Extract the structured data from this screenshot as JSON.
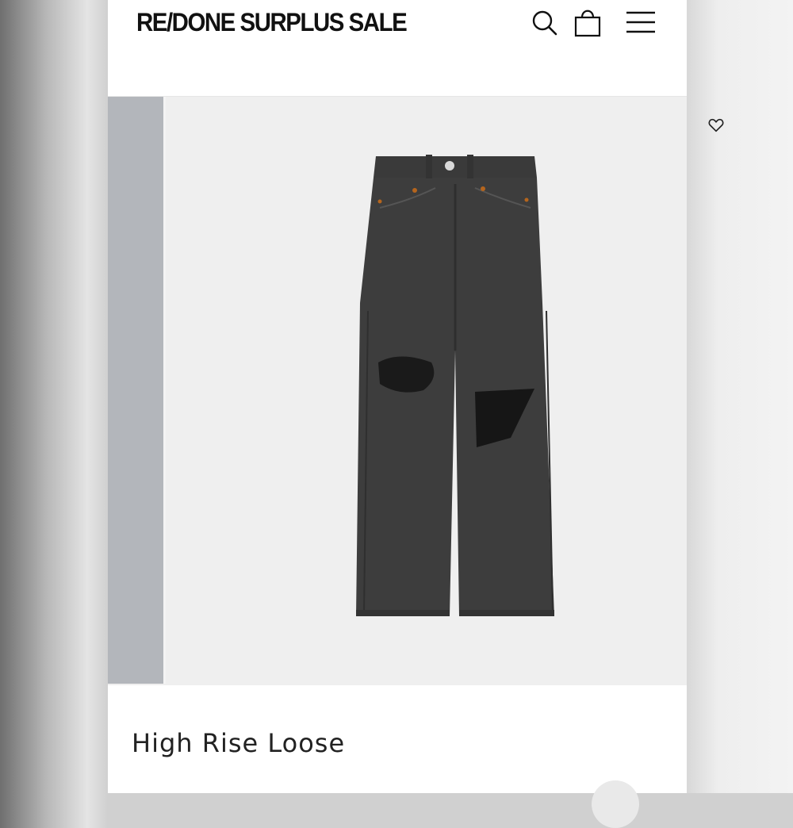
{
  "header": {
    "brand": "RE/DONE SURPLUS SALE",
    "icons": [
      "search-icon",
      "shopping-bag-icon",
      "hamburger-menu-icon"
    ]
  },
  "product": {
    "title": "High Rise Loose",
    "image_alt": "black distressed jeans",
    "wishlist_icon": "heart-icon"
  }
}
